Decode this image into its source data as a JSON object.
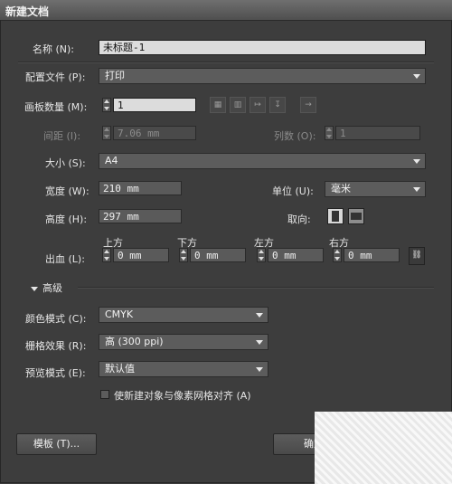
{
  "dialog": {
    "title": "新建文档"
  },
  "name": {
    "label": "名称 (N):",
    "value": "未标题-1"
  },
  "profile": {
    "label": "配置文件 (P):",
    "value": "打印"
  },
  "artboards": {
    "count_label": "画板数量 (M):",
    "count_value": "1",
    "spacing_label": "间距 (I):",
    "spacing_value": "7.06 mm",
    "columns_label": "列数 (O):",
    "columns_value": "1"
  },
  "size": {
    "label": "大小 (S):",
    "value": "A4"
  },
  "width": {
    "label": "宽度 (W):",
    "value": "210 mm"
  },
  "units": {
    "label": "单位 (U):",
    "value": "毫米"
  },
  "height": {
    "label": "高度 (H):",
    "value": "297 mm"
  },
  "orientation": {
    "label": "取向:"
  },
  "bleed": {
    "label": "出血 (L):",
    "top_label": "上方",
    "top_value": "0 mm",
    "bottom_label": "下方",
    "bottom_value": "0 mm",
    "left_label": "左方",
    "left_value": "0 mm",
    "right_label": "右方",
    "right_value": "0 mm"
  },
  "advanced": {
    "title": "高级",
    "color_mode_label": "颜色模式 (C):",
    "color_mode_value": "CMYK",
    "raster_label": "栅格效果 (R):",
    "raster_value": "高 (300 ppi)",
    "preview_label": "预览模式 (E):",
    "preview_value": "默认值",
    "align_label": "使新建对象与像素网格对齐 (A)"
  },
  "buttons": {
    "templates": "模板 (T)...",
    "ok": "确定"
  }
}
